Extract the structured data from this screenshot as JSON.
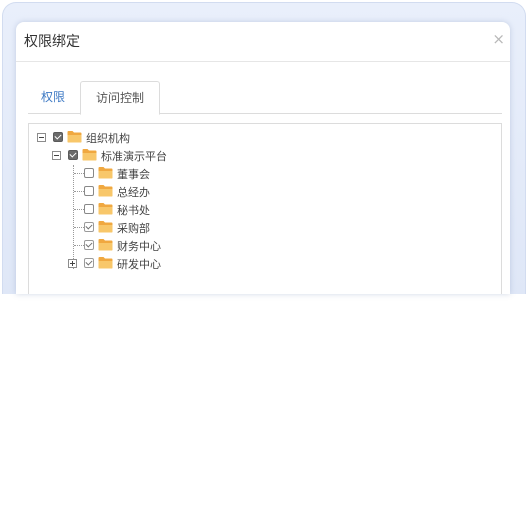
{
  "dialog": {
    "title": "权限绑定",
    "close_icon": "close-icon",
    "close_glyph": "×"
  },
  "tabs": [
    {
      "label": "权限",
      "active": false
    },
    {
      "label": "访问控制",
      "active": true
    }
  ],
  "tree": {
    "root": {
      "label": "组织机构",
      "checked": true,
      "expanded": true,
      "icon": "folder-icon"
    },
    "platform": {
      "label": "标准演示平台",
      "checked": true,
      "expanded": true,
      "icon": "folder-icon"
    },
    "children": [
      {
        "label": "董事会",
        "checked": false,
        "icon": "folder-icon"
      },
      {
        "label": "总经办",
        "checked": false,
        "icon": "folder-icon"
      },
      {
        "label": "秘书处",
        "checked": false,
        "icon": "folder-icon"
      },
      {
        "label": "采购部",
        "checked": true,
        "icon": "folder-icon"
      },
      {
        "label": "财务中心",
        "checked": true,
        "icon": "folder-icon"
      },
      {
        "label": "研发中心",
        "checked": true,
        "expanded": false,
        "icon": "folder-icon"
      }
    ]
  },
  "colors": {
    "accent": "#3d79c4",
    "folder": "#f8c76a",
    "folder_dark": "#f0a840"
  }
}
